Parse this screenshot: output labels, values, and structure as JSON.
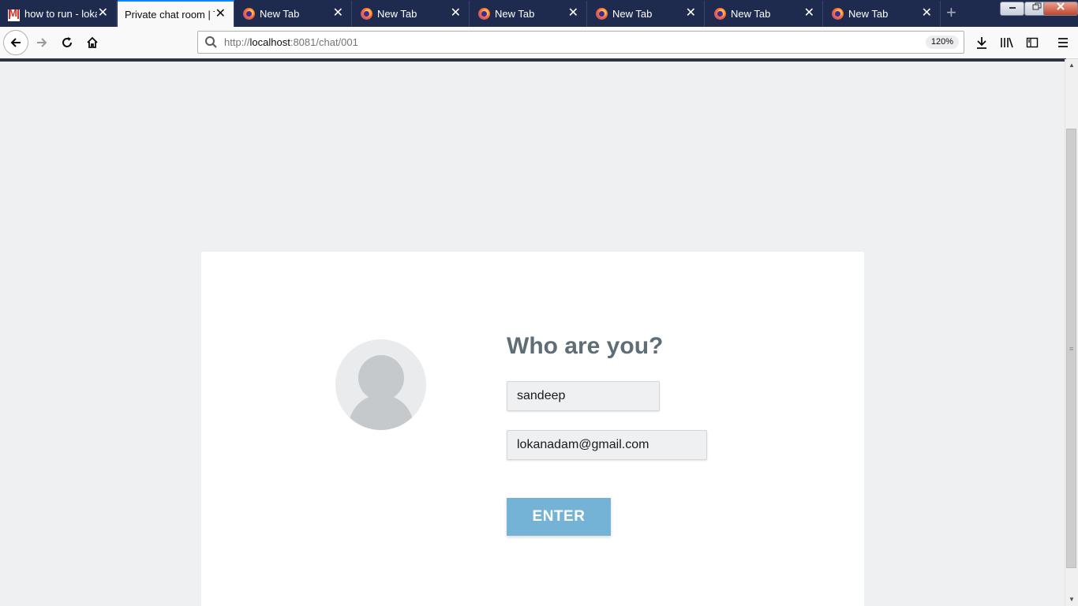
{
  "browser": {
    "tabs": [
      {
        "title": "how to run - loka",
        "icon": "gmail-icon",
        "active": false
      },
      {
        "title": "Private chat room | T",
        "icon": "",
        "active": true
      },
      {
        "title": "New Tab",
        "icon": "firefox-icon",
        "active": false
      },
      {
        "title": "New Tab",
        "icon": "firefox-icon",
        "active": false
      },
      {
        "title": "New Tab",
        "icon": "firefox-icon",
        "active": false
      },
      {
        "title": "New Tab",
        "icon": "firefox-icon",
        "active": false
      },
      {
        "title": "New Tab",
        "icon": "firefox-icon",
        "active": false
      },
      {
        "title": "New Tab",
        "icon": "firefox-icon",
        "active": false
      }
    ],
    "close_glyph": "✕",
    "new_tab_glyph": "+",
    "url_scheme": "http://",
    "url_host": "localhost",
    "url_path": ":8081/chat/001",
    "zoom": "120%"
  },
  "login": {
    "title": "Who are you?",
    "name_value": "sandeep",
    "email_value": "lokanadam@gmail.com",
    "enter_label": "ENTER"
  },
  "colors": {
    "tab_strip": "#1e2a4e",
    "page_background": "#eff0f2",
    "title_color": "#5f6e76",
    "enter_button": "#74b3d6"
  }
}
